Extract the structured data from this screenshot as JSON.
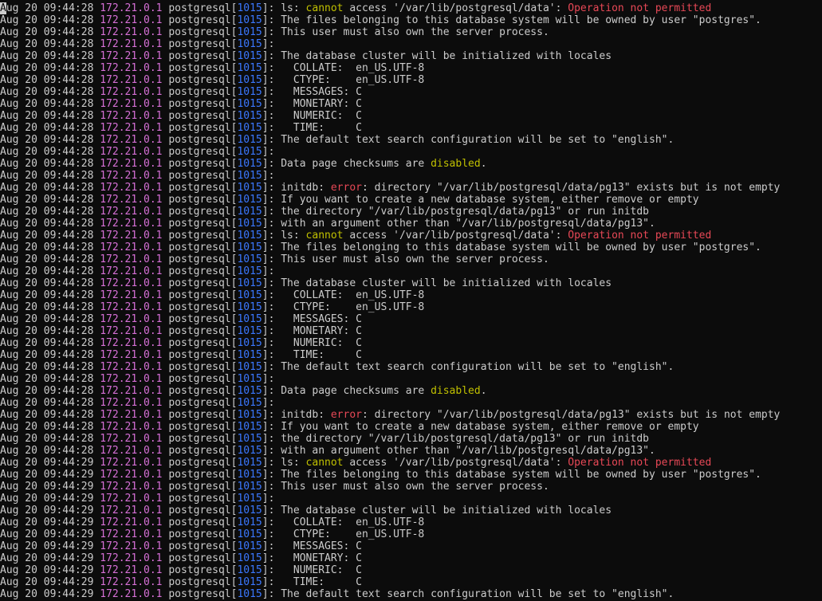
{
  "colors": {
    "background": "#0c0c0c",
    "text": "#cccccc",
    "ip": "#d670d6",
    "pid": "#3b78ff",
    "yellow": "#c0c000",
    "red": "#e74856"
  },
  "cursor_char": "A",
  "lines": [
    {
      "ts": "Aug 20 09:44:28",
      "ip": "172.21.0.1",
      "proc": "postgresql",
      "pid": "1015",
      "msg": [
        {
          "t": "ls: "
        },
        {
          "t": "cannot",
          "c": "yellow"
        },
        {
          "t": " access '/var/lib/postgresql/data': "
        },
        {
          "t": "Operation not permitted",
          "c": "red"
        }
      ]
    },
    {
      "ts": "Aug 20 09:44:28",
      "ip": "172.21.0.1",
      "proc": "postgresql",
      "pid": "1015",
      "msg": [
        {
          "t": "The files belonging to this database system will be owned by user \"postgres\"."
        }
      ]
    },
    {
      "ts": "Aug 20 09:44:28",
      "ip": "172.21.0.1",
      "proc": "postgresql",
      "pid": "1015",
      "msg": [
        {
          "t": "This user must also own the server process."
        }
      ]
    },
    {
      "ts": "Aug 20 09:44:28",
      "ip": "172.21.0.1",
      "proc": "postgresql",
      "pid": "1015",
      "msg": []
    },
    {
      "ts": "Aug 20 09:44:28",
      "ip": "172.21.0.1",
      "proc": "postgresql",
      "pid": "1015",
      "msg": [
        {
          "t": "The database cluster will be initialized with locales"
        }
      ]
    },
    {
      "ts": "Aug 20 09:44:28",
      "ip": "172.21.0.1",
      "proc": "postgresql",
      "pid": "1015",
      "msg": [
        {
          "t": "  COLLATE:  en_US.UTF-8"
        }
      ]
    },
    {
      "ts": "Aug 20 09:44:28",
      "ip": "172.21.0.1",
      "proc": "postgresql",
      "pid": "1015",
      "msg": [
        {
          "t": "  CTYPE:    en_US.UTF-8"
        }
      ]
    },
    {
      "ts": "Aug 20 09:44:28",
      "ip": "172.21.0.1",
      "proc": "postgresql",
      "pid": "1015",
      "msg": [
        {
          "t": "  MESSAGES: C"
        }
      ]
    },
    {
      "ts": "Aug 20 09:44:28",
      "ip": "172.21.0.1",
      "proc": "postgresql",
      "pid": "1015",
      "msg": [
        {
          "t": "  MONETARY: C"
        }
      ]
    },
    {
      "ts": "Aug 20 09:44:28",
      "ip": "172.21.0.1",
      "proc": "postgresql",
      "pid": "1015",
      "msg": [
        {
          "t": "  NUMERIC:  C"
        }
      ]
    },
    {
      "ts": "Aug 20 09:44:28",
      "ip": "172.21.0.1",
      "proc": "postgresql",
      "pid": "1015",
      "msg": [
        {
          "t": "  TIME:     C"
        }
      ]
    },
    {
      "ts": "Aug 20 09:44:28",
      "ip": "172.21.0.1",
      "proc": "postgresql",
      "pid": "1015",
      "msg": [
        {
          "t": "The default text search configuration will be set to \"english\"."
        }
      ]
    },
    {
      "ts": "Aug 20 09:44:28",
      "ip": "172.21.0.1",
      "proc": "postgresql",
      "pid": "1015",
      "msg": []
    },
    {
      "ts": "Aug 20 09:44:28",
      "ip": "172.21.0.1",
      "proc": "postgresql",
      "pid": "1015",
      "msg": [
        {
          "t": "Data page checksums are "
        },
        {
          "t": "disabled",
          "c": "yellow"
        },
        {
          "t": "."
        }
      ]
    },
    {
      "ts": "Aug 20 09:44:28",
      "ip": "172.21.0.1",
      "proc": "postgresql",
      "pid": "1015",
      "msg": []
    },
    {
      "ts": "Aug 20 09:44:28",
      "ip": "172.21.0.1",
      "proc": "postgresql",
      "pid": "1015",
      "msg": [
        {
          "t": "initdb: "
        },
        {
          "t": "error",
          "c": "red"
        },
        {
          "t": ": directory \"/var/lib/postgresql/data/pg13\" exists but is not empty"
        }
      ]
    },
    {
      "ts": "Aug 20 09:44:28",
      "ip": "172.21.0.1",
      "proc": "postgresql",
      "pid": "1015",
      "msg": [
        {
          "t": "If you want to create a new database system, either remove or empty"
        }
      ]
    },
    {
      "ts": "Aug 20 09:44:28",
      "ip": "172.21.0.1",
      "proc": "postgresql",
      "pid": "1015",
      "msg": [
        {
          "t": "the directory \"/var/lib/postgresql/data/pg13\" or run initdb"
        }
      ]
    },
    {
      "ts": "Aug 20 09:44:28",
      "ip": "172.21.0.1",
      "proc": "postgresql",
      "pid": "1015",
      "msg": [
        {
          "t": "with an argument other than \"/var/lib/postgresql/data/pg13\"."
        }
      ]
    },
    {
      "ts": "Aug 20 09:44:28",
      "ip": "172.21.0.1",
      "proc": "postgresql",
      "pid": "1015",
      "msg": [
        {
          "t": "ls: "
        },
        {
          "t": "cannot",
          "c": "yellow"
        },
        {
          "t": " access '/var/lib/postgresql/data': "
        },
        {
          "t": "Operation not permitted",
          "c": "red"
        }
      ]
    },
    {
      "ts": "Aug 20 09:44:28",
      "ip": "172.21.0.1",
      "proc": "postgresql",
      "pid": "1015",
      "msg": [
        {
          "t": "The files belonging to this database system will be owned by user \"postgres\"."
        }
      ]
    },
    {
      "ts": "Aug 20 09:44:28",
      "ip": "172.21.0.1",
      "proc": "postgresql",
      "pid": "1015",
      "msg": [
        {
          "t": "This user must also own the server process."
        }
      ]
    },
    {
      "ts": "Aug 20 09:44:28",
      "ip": "172.21.0.1",
      "proc": "postgresql",
      "pid": "1015",
      "msg": []
    },
    {
      "ts": "Aug 20 09:44:28",
      "ip": "172.21.0.1",
      "proc": "postgresql",
      "pid": "1015",
      "msg": [
        {
          "t": "The database cluster will be initialized with locales"
        }
      ]
    },
    {
      "ts": "Aug 20 09:44:28",
      "ip": "172.21.0.1",
      "proc": "postgresql",
      "pid": "1015",
      "msg": [
        {
          "t": "  COLLATE:  en_US.UTF-8"
        }
      ]
    },
    {
      "ts": "Aug 20 09:44:28",
      "ip": "172.21.0.1",
      "proc": "postgresql",
      "pid": "1015",
      "msg": [
        {
          "t": "  CTYPE:    en_US.UTF-8"
        }
      ]
    },
    {
      "ts": "Aug 20 09:44:28",
      "ip": "172.21.0.1",
      "proc": "postgresql",
      "pid": "1015",
      "msg": [
        {
          "t": "  MESSAGES: C"
        }
      ]
    },
    {
      "ts": "Aug 20 09:44:28",
      "ip": "172.21.0.1",
      "proc": "postgresql",
      "pid": "1015",
      "msg": [
        {
          "t": "  MONETARY: C"
        }
      ]
    },
    {
      "ts": "Aug 20 09:44:28",
      "ip": "172.21.0.1",
      "proc": "postgresql",
      "pid": "1015",
      "msg": [
        {
          "t": "  NUMERIC:  C"
        }
      ]
    },
    {
      "ts": "Aug 20 09:44:28",
      "ip": "172.21.0.1",
      "proc": "postgresql",
      "pid": "1015",
      "msg": [
        {
          "t": "  TIME:     C"
        }
      ]
    },
    {
      "ts": "Aug 20 09:44:28",
      "ip": "172.21.0.1",
      "proc": "postgresql",
      "pid": "1015",
      "msg": [
        {
          "t": "The default text search configuration will be set to \"english\"."
        }
      ]
    },
    {
      "ts": "Aug 20 09:44:28",
      "ip": "172.21.0.1",
      "proc": "postgresql",
      "pid": "1015",
      "msg": []
    },
    {
      "ts": "Aug 20 09:44:28",
      "ip": "172.21.0.1",
      "proc": "postgresql",
      "pid": "1015",
      "msg": [
        {
          "t": "Data page checksums are "
        },
        {
          "t": "disabled",
          "c": "yellow"
        },
        {
          "t": "."
        }
      ]
    },
    {
      "ts": "Aug 20 09:44:28",
      "ip": "172.21.0.1",
      "proc": "postgresql",
      "pid": "1015",
      "msg": []
    },
    {
      "ts": "Aug 20 09:44:28",
      "ip": "172.21.0.1",
      "proc": "postgresql",
      "pid": "1015",
      "msg": [
        {
          "t": "initdb: "
        },
        {
          "t": "error",
          "c": "red"
        },
        {
          "t": ": directory \"/var/lib/postgresql/data/pg13\" exists but is not empty"
        }
      ]
    },
    {
      "ts": "Aug 20 09:44:28",
      "ip": "172.21.0.1",
      "proc": "postgresql",
      "pid": "1015",
      "msg": [
        {
          "t": "If you want to create a new database system, either remove or empty"
        }
      ]
    },
    {
      "ts": "Aug 20 09:44:28",
      "ip": "172.21.0.1",
      "proc": "postgresql",
      "pid": "1015",
      "msg": [
        {
          "t": "the directory \"/var/lib/postgresql/data/pg13\" or run initdb"
        }
      ]
    },
    {
      "ts": "Aug 20 09:44:28",
      "ip": "172.21.0.1",
      "proc": "postgresql",
      "pid": "1015",
      "msg": [
        {
          "t": "with an argument other than \"/var/lib/postgresql/data/pg13\"."
        }
      ]
    },
    {
      "ts": "Aug 20 09:44:29",
      "ip": "172.21.0.1",
      "proc": "postgresql",
      "pid": "1015",
      "msg": [
        {
          "t": "ls: "
        },
        {
          "t": "cannot",
          "c": "yellow"
        },
        {
          "t": " access '/var/lib/postgresql/data': "
        },
        {
          "t": "Operation not permitted",
          "c": "red"
        }
      ]
    },
    {
      "ts": "Aug 20 09:44:29",
      "ip": "172.21.0.1",
      "proc": "postgresql",
      "pid": "1015",
      "msg": [
        {
          "t": "The files belonging to this database system will be owned by user \"postgres\"."
        }
      ]
    },
    {
      "ts": "Aug 20 09:44:29",
      "ip": "172.21.0.1",
      "proc": "postgresql",
      "pid": "1015",
      "msg": [
        {
          "t": "This user must also own the server process."
        }
      ]
    },
    {
      "ts": "Aug 20 09:44:29",
      "ip": "172.21.0.1",
      "proc": "postgresql",
      "pid": "1015",
      "msg": []
    },
    {
      "ts": "Aug 20 09:44:29",
      "ip": "172.21.0.1",
      "proc": "postgresql",
      "pid": "1015",
      "msg": [
        {
          "t": "The database cluster will be initialized with locales"
        }
      ]
    },
    {
      "ts": "Aug 20 09:44:29",
      "ip": "172.21.0.1",
      "proc": "postgresql",
      "pid": "1015",
      "msg": [
        {
          "t": "  COLLATE:  en_US.UTF-8"
        }
      ]
    },
    {
      "ts": "Aug 20 09:44:29",
      "ip": "172.21.0.1",
      "proc": "postgresql",
      "pid": "1015",
      "msg": [
        {
          "t": "  CTYPE:    en_US.UTF-8"
        }
      ]
    },
    {
      "ts": "Aug 20 09:44:29",
      "ip": "172.21.0.1",
      "proc": "postgresql",
      "pid": "1015",
      "msg": [
        {
          "t": "  MESSAGES: C"
        }
      ]
    },
    {
      "ts": "Aug 20 09:44:29",
      "ip": "172.21.0.1",
      "proc": "postgresql",
      "pid": "1015",
      "msg": [
        {
          "t": "  MONETARY: C"
        }
      ]
    },
    {
      "ts": "Aug 20 09:44:29",
      "ip": "172.21.0.1",
      "proc": "postgresql",
      "pid": "1015",
      "msg": [
        {
          "t": "  NUMERIC:  C"
        }
      ]
    },
    {
      "ts": "Aug 20 09:44:29",
      "ip": "172.21.0.1",
      "proc": "postgresql",
      "pid": "1015",
      "msg": [
        {
          "t": "  TIME:     C"
        }
      ]
    },
    {
      "ts": "Aug 20 09:44:29",
      "ip": "172.21.0.1",
      "proc": "postgresql",
      "pid": "1015",
      "msg": [
        {
          "t": "The default text search configuration will be set to \"english\"."
        }
      ]
    }
  ]
}
